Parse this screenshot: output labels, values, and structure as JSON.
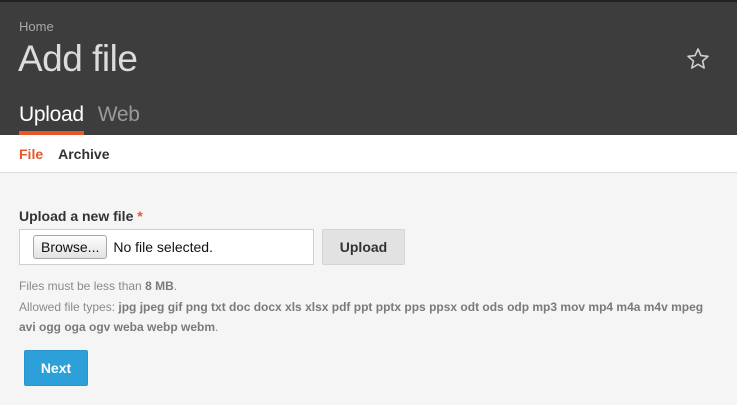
{
  "header": {
    "breadcrumb": "Home",
    "title": "Add file",
    "favorite_icon": "star-icon",
    "tabs": [
      {
        "label": "Upload",
        "active": true
      },
      {
        "label": "Web",
        "active": false
      }
    ]
  },
  "subtabs": [
    {
      "label": "File",
      "active": true
    },
    {
      "label": "Archive",
      "active": false
    }
  ],
  "form": {
    "label": "Upload a new file",
    "required_marker": "*",
    "browse_label": "Browse...",
    "file_status": "No file selected.",
    "upload_label": "Upload",
    "size_prefix": "Files must be less than",
    "size_limit": "8 MB",
    "size_suffix": ".",
    "types_prefix": "Allowed file types:",
    "types": "jpg jpeg gif png txt doc docx xls xlsx pdf ppt pptx pps ppsx odt ods odp mp3 mov mp4 m4a m4v mpeg avi ogg oga ogv weba webp webm",
    "types_suffix": ".",
    "next_label": "Next"
  },
  "colors": {
    "accent": "#e8562a",
    "header_bg": "#3d3d3d",
    "primary_button": "#2d9fd9"
  }
}
